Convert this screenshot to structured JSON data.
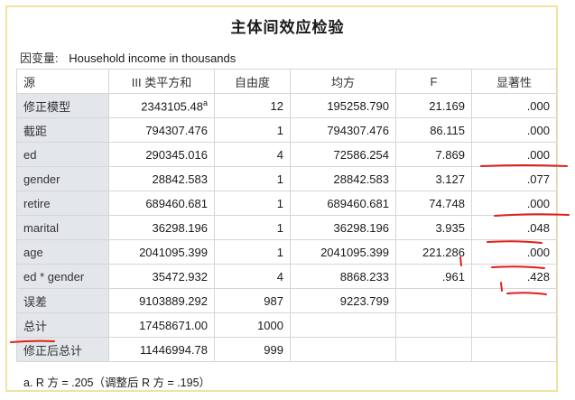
{
  "title": "主体间效应检验",
  "dependent": {
    "label": "因变量:",
    "value": "Household income in thousands"
  },
  "table": {
    "headers": [
      "源",
      "III 类平方和",
      "自由度",
      "均方",
      "F",
      "显著性"
    ],
    "rows": [
      {
        "source": "修正模型",
        "ss": "2343105.48",
        "ss_sup": "a",
        "df": "12",
        "ms": "195258.790",
        "f": "21.169",
        "sig": ".000"
      },
      {
        "source": "截距",
        "ss": "794307.476",
        "df": "1",
        "ms": "794307.476",
        "f": "86.115",
        "sig": ".000"
      },
      {
        "source": "ed",
        "ss": "290345.016",
        "df": "4",
        "ms": "72586.254",
        "f": "7.869",
        "sig": ".000"
      },
      {
        "source": "gender",
        "ss": "28842.583",
        "df": "1",
        "ms": "28842.583",
        "f": "3.127",
        "sig": ".077"
      },
      {
        "source": "retire",
        "ss": "689460.681",
        "df": "1",
        "ms": "689460.681",
        "f": "74.748",
        "sig": ".000"
      },
      {
        "source": "marital",
        "ss": "36298.196",
        "df": "1",
        "ms": "36298.196",
        "f": "3.935",
        "sig": ".048"
      },
      {
        "source": "age",
        "ss": "2041095.399",
        "df": "1",
        "ms": "2041095.399",
        "f": "221.286",
        "sig": ".000"
      },
      {
        "source": "ed * gender",
        "ss": "35472.932",
        "df": "4",
        "ms": "8868.233",
        "f": ".961",
        "sig": ".428"
      },
      {
        "source": "误差",
        "ss": "9103889.292",
        "df": "987",
        "ms": "9223.799",
        "f": "",
        "sig": ""
      },
      {
        "source": "总计",
        "ss": "17458671.00",
        "df": "1000",
        "ms": "",
        "f": "",
        "sig": ""
      },
      {
        "source": "修正后总计",
        "ss": "11446994.78",
        "df": "999",
        "ms": "",
        "f": "",
        "sig": ""
      }
    ]
  },
  "footnote": "a. R 方 = .205（调整后 R 方 = .195）",
  "colors": {
    "row_label_bg": "#e3e6ea",
    "frame": "#f1e3a0",
    "annotation": "#e0201a"
  }
}
